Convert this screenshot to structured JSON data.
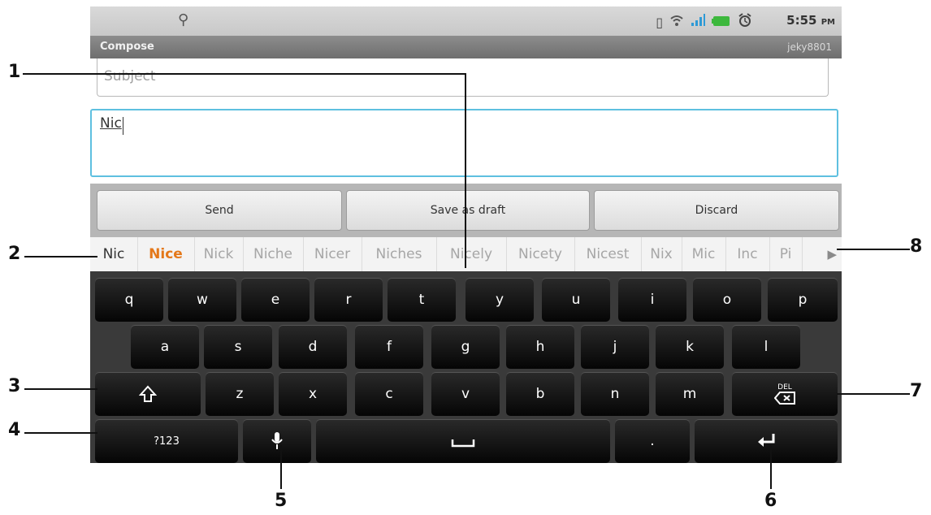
{
  "status_bar": {
    "time": "5:55",
    "ampm": "PM",
    "icons": [
      "usb-icon",
      "vibrate-icon",
      "wifi-icon",
      "signal-icon",
      "battery-icon",
      "alarm-icon"
    ]
  },
  "title_bar": {
    "title": "Compose",
    "account": "jeky8801"
  },
  "compose": {
    "subject_placeholder": "Subject",
    "body_text": "Nic"
  },
  "actions": {
    "send": "Send",
    "save_draft": "Save as draft",
    "discard": "Discard"
  },
  "suggestions": [
    "Nic",
    "Nice",
    "Nick",
    "Niche",
    "Nicer",
    "Niches",
    "Nicely",
    "Nicety",
    "Nicest",
    "Nix",
    "Mic",
    "Inc",
    "Pi"
  ],
  "keyboard": {
    "row1": [
      "q",
      "w",
      "e",
      "r",
      "t",
      "y",
      "u",
      "i",
      "o",
      "p"
    ],
    "row2": [
      "a",
      "s",
      "d",
      "f",
      "g",
      "h",
      "j",
      "k",
      "l"
    ],
    "row3": [
      "z",
      "x",
      "c",
      "v",
      "b",
      "n",
      "m"
    ],
    "symbols_label": "?123",
    "period_label": ".",
    "delete_label": "DEL"
  },
  "callouts": [
    "1",
    "2",
    "3",
    "4",
    "5",
    "6",
    "7",
    "8"
  ],
  "colors": {
    "accent_field": "#5ec0e0",
    "suggestion_best": "#e4781a",
    "keyboard_bg": "#3a3a3a"
  }
}
